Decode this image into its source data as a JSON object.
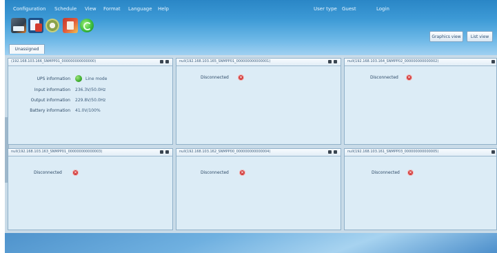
{
  "menu": [
    "Configuration",
    "Schedule",
    "View",
    "Format",
    "Language",
    "Help"
  ],
  "user": {
    "type_label": "User type",
    "type_value": "Guest",
    "login": "Login"
  },
  "toolbar_icons": [
    "configuration-icon",
    "schedule-icon",
    "view-icon",
    "format-icon",
    "refresh-icon"
  ],
  "view_buttons": {
    "graphics": "Graphics view",
    "list": "List view"
  },
  "tab": "Unassigned",
  "panels": [
    {
      "title": "(192.168.103.166_SNMPP01_000000000000000)",
      "info": [
        {
          "label": "UPS information",
          "value": "Line mode"
        },
        {
          "label": "Input information",
          "value": "236.3V/50.0Hz"
        },
        {
          "label": "Output information",
          "value": "229.8V/50.0Hz"
        },
        {
          "label": "Battery information",
          "value": "41.0V/100%"
        }
      ]
    },
    {
      "title": "null(192.168.103.165_SNMPP01_000000000000001)",
      "status": "Disconnected"
    },
    {
      "title": "null(192.168.103.164_SNMPP02_000000000000002)",
      "status": "Disconnected"
    },
    {
      "title": "null(192.168.103.163_SNMPP01_000000000000003)",
      "status": "Disconnected"
    },
    {
      "title": "null(192.168.103.162_SNMPP00_000000000000004)",
      "status": "Disconnected"
    },
    {
      "title": "null(192.168.103.161_SNMPP03_000000000000005)",
      "status": "Disconnected"
    }
  ],
  "colors": {
    "title_bar": "#3d9ad6",
    "panel_bg": "#dcecf6",
    "disconnected": "#d13c3c",
    "online": "#3fae2f"
  }
}
